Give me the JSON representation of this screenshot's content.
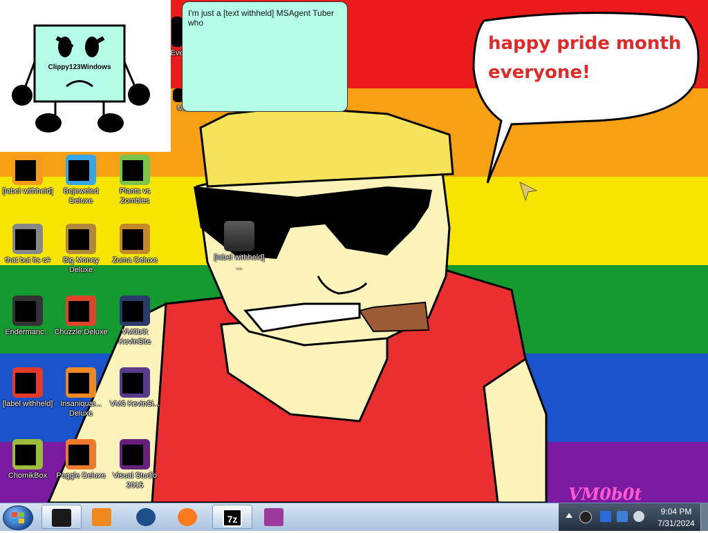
{
  "wallpaper": {
    "stripes": [
      "#e91b1b",
      "#f7a013",
      "#f5e500",
      "#159a32",
      "#1a54cc",
      "#7a1aa0"
    ],
    "art_colors": {
      "hat": "#f6e35a",
      "skin": "#fbf3b9",
      "shirt": "#ea2f30",
      "cigar": "#9c5a35",
      "glasses": "#000000"
    },
    "speech_bubble": {
      "line1": "happy pride month",
      "line2": "everyone!"
    },
    "watermark": "VM0b0t"
  },
  "agent": {
    "name": "Clippy123Windows",
    "balloon_text": "I'm just a [text withheld] MSAgent Tuber who"
  },
  "desktop_icons": [
    {
      "label": "[label withheld]",
      "icon": "document-icon",
      "color": "#f29b1c"
    },
    {
      "label": "Bejeweled Deluxe",
      "icon": "gem-icon",
      "color": "#35a6e8"
    },
    {
      "label": "Plants vs Zombies",
      "icon": "plant-icon",
      "color": "#7cc34a"
    },
    {
      "label": "that but its c#",
      "icon": "stack-icon",
      "color": "#888888"
    },
    {
      "label": "Big Money Deluxe",
      "icon": "money-bag-icon",
      "color": "#b08a3a"
    },
    {
      "label": "Zuma Deluxe",
      "icon": "frog-idol-icon",
      "color": "#c48a2a"
    },
    {
      "label": "Endermanc...",
      "icon": "terminal-icon",
      "color": "#333333"
    },
    {
      "label": "Chuzzle Deluxe",
      "icon": "chuzzle-icon",
      "color": "#e0442a"
    },
    {
      "label": "VM0b0t KevinSite",
      "icon": "website-icon",
      "color": "#2a3a6a"
    },
    {
      "label": "[label withheld]",
      "icon": "red-circle-icon",
      "color": "#e23b2b"
    },
    {
      "label": "Insaniquar... Deluxe",
      "icon": "fish-icon",
      "color": "#f08a20"
    },
    {
      "label": "VM0 KevinSi...",
      "icon": "document-purple-icon",
      "color": "#5a3a8a"
    },
    {
      "label": "ChomikBox",
      "icon": "hamster-icon",
      "color": "#9cbc3a"
    },
    {
      "label": "Peggle Deluxe",
      "icon": "peggle-icon",
      "color": "#f07a2a"
    },
    {
      "label": "Visual Studio 2015",
      "icon": "visual-studio-icon",
      "color": "#68217a"
    }
  ],
  "partial_icons": [
    {
      "label": "Eve",
      "icon": "app-icon"
    },
    {
      "label": "MASH",
      "icon": "app-icon"
    }
  ],
  "folder_icon": {
    "label": "[label withheld] ...",
    "icon": "folder-icon"
  },
  "taskbar": {
    "pinned": [
      {
        "name": "command-prompt-icon",
        "color": "#1a1a1a",
        "active": true
      },
      {
        "name": "media-player-icon",
        "color": "#f08a20",
        "active": false
      },
      {
        "name": "globe-icon",
        "color": "#1f4f8a",
        "active": false
      },
      {
        "name": "firefox-icon",
        "color": "#ff7a1a",
        "active": false
      },
      {
        "name": "7zip-icon",
        "color": "#000000",
        "active": true,
        "text": "7z"
      },
      {
        "name": "winrar-icon",
        "color": "#9c3a9c",
        "active": false
      }
    ],
    "tray_icons": [
      "agent-tray-icon",
      "sync-icon",
      "network-icon",
      "volume-icon"
    ],
    "time": "9:04 PM",
    "date": "7/31/2024"
  }
}
